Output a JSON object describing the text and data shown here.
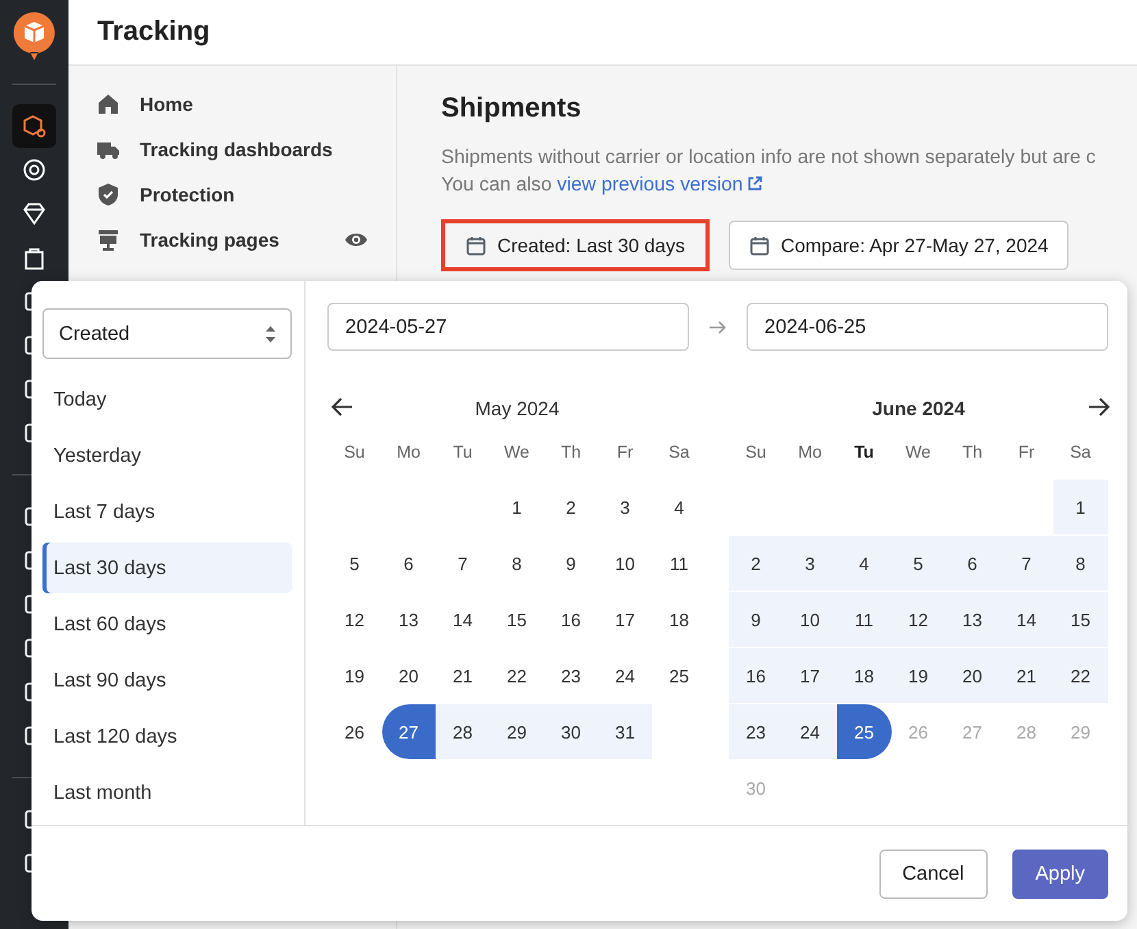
{
  "header": {
    "title": "Tracking"
  },
  "rail_items": [
    {
      "selected": true
    },
    {
      "selected": false
    },
    {
      "selected": false
    },
    {
      "selected": false
    }
  ],
  "sidebar": {
    "items": [
      {
        "label": "Home",
        "kind": "home",
        "preview": false
      },
      {
        "label": "Tracking dashboards",
        "kind": "truck",
        "preview": false
      },
      {
        "label": "Protection",
        "kind": "shield",
        "preview": false
      },
      {
        "label": "Tracking pages",
        "kind": "monitor",
        "preview": true
      }
    ]
  },
  "main": {
    "title": "Shipments",
    "description": "Shipments without carrier or location info are not shown separately but are c",
    "link_prefix": "You can also ",
    "link": "view previous version",
    "filters": [
      {
        "label": "Created: Last 30 days",
        "highlighted": true
      },
      {
        "label": "Compare: Apr 27-May 27, 2024",
        "highlighted": false
      }
    ]
  },
  "picker": {
    "field": {
      "value": "Created"
    },
    "presets": [
      {
        "label": "Today",
        "selected": false
      },
      {
        "label": "Yesterday",
        "selected": false
      },
      {
        "label": "Last 7 days",
        "selected": false
      },
      {
        "label": "Last 30 days",
        "selected": true
      },
      {
        "label": "Last 60 days",
        "selected": false
      },
      {
        "label": "Last 90 days",
        "selected": false
      },
      {
        "label": "Last 120 days",
        "selected": false
      },
      {
        "label": "Last month",
        "selected": false
      }
    ],
    "start_date": "2024-05-27",
    "end_date": "2024-06-25",
    "calendars": [
      {
        "title": "May 2024",
        "current": false,
        "prev_arrow": true,
        "next_arrow": false,
        "weekdays": [
          {
            "label": "Su",
            "today": false
          },
          {
            "label": "Mo",
            "today": false
          },
          {
            "label": "Tu",
            "today": false
          },
          {
            "label": "We",
            "today": false
          },
          {
            "label": "Th",
            "today": false
          },
          {
            "label": "Fr",
            "today": false
          },
          {
            "label": "Sa",
            "today": false
          }
        ],
        "weeks": [
          [
            {
              "kind": "blank"
            },
            {
              "kind": "blank"
            },
            {
              "kind": "blank"
            },
            {
              "label": "1",
              "kind": "day"
            },
            {
              "label": "2",
              "kind": "day"
            },
            {
              "label": "3",
              "kind": "day"
            },
            {
              "label": "4",
              "kind": "day"
            }
          ],
          [
            {
              "label": "5",
              "kind": "day"
            },
            {
              "label": "6",
              "kind": "day"
            },
            {
              "label": "7",
              "kind": "day"
            },
            {
              "label": "8",
              "kind": "day"
            },
            {
              "label": "9",
              "kind": "day"
            },
            {
              "label": "10",
              "kind": "day"
            },
            {
              "label": "11",
              "kind": "day"
            }
          ],
          [
            {
              "label": "12",
              "kind": "day"
            },
            {
              "label": "13",
              "kind": "day"
            },
            {
              "label": "14",
              "kind": "day"
            },
            {
              "label": "15",
              "kind": "day"
            },
            {
              "label": "16",
              "kind": "day"
            },
            {
              "label": "17",
              "kind": "day"
            },
            {
              "label": "18",
              "kind": "day"
            }
          ],
          [
            {
              "label": "19",
              "kind": "day"
            },
            {
              "label": "20",
              "kind": "day"
            },
            {
              "label": "21",
              "kind": "day"
            },
            {
              "label": "22",
              "kind": "day"
            },
            {
              "label": "23",
              "kind": "day"
            },
            {
              "label": "24",
              "kind": "day"
            },
            {
              "label": "25",
              "kind": "day"
            }
          ],
          [
            {
              "label": "26",
              "kind": "day"
            },
            {
              "label": "27",
              "kind": "start"
            },
            {
              "label": "28",
              "kind": "range"
            },
            {
              "label": "29",
              "kind": "range"
            },
            {
              "label": "30",
              "kind": "range"
            },
            {
              "label": "31",
              "kind": "range"
            },
            {
              "kind": "blank"
            }
          ]
        ]
      },
      {
        "title": "June 2024",
        "current": true,
        "prev_arrow": false,
        "next_arrow": true,
        "weekdays": [
          {
            "label": "Su",
            "today": false
          },
          {
            "label": "Mo",
            "today": false
          },
          {
            "label": "Tu",
            "today": true
          },
          {
            "label": "We",
            "today": false
          },
          {
            "label": "Th",
            "today": false
          },
          {
            "label": "Fr",
            "today": false
          },
          {
            "label": "Sa",
            "today": false
          }
        ],
        "weeks": [
          [
            {
              "kind": "blank"
            },
            {
              "kind": "blank"
            },
            {
              "kind": "blank"
            },
            {
              "kind": "blank"
            },
            {
              "kind": "blank"
            },
            {
              "kind": "blank"
            },
            {
              "label": "1",
              "kind": "range"
            }
          ],
          [
            {
              "label": "2",
              "kind": "range"
            },
            {
              "label": "3",
              "kind": "range"
            },
            {
              "label": "4",
              "kind": "range"
            },
            {
              "label": "5",
              "kind": "range"
            },
            {
              "label": "6",
              "kind": "range"
            },
            {
              "label": "7",
              "kind": "range"
            },
            {
              "label": "8",
              "kind": "range"
            }
          ],
          [
            {
              "label": "9",
              "kind": "range"
            },
            {
              "label": "10",
              "kind": "range"
            },
            {
              "label": "11",
              "kind": "range"
            },
            {
              "label": "12",
              "kind": "range"
            },
            {
              "label": "13",
              "kind": "range"
            },
            {
              "label": "14",
              "kind": "range"
            },
            {
              "label": "15",
              "kind": "range"
            }
          ],
          [
            {
              "label": "16",
              "kind": "range"
            },
            {
              "label": "17",
              "kind": "range"
            },
            {
              "label": "18",
              "kind": "range"
            },
            {
              "label": "19",
              "kind": "range"
            },
            {
              "label": "20",
              "kind": "range"
            },
            {
              "label": "21",
              "kind": "range"
            },
            {
              "label": "22",
              "kind": "range"
            }
          ],
          [
            {
              "label": "23",
              "kind": "range"
            },
            {
              "label": "24",
              "kind": "range"
            },
            {
              "label": "25",
              "kind": "end"
            },
            {
              "label": "26",
              "kind": "disabled"
            },
            {
              "label": "27",
              "kind": "disabled"
            },
            {
              "label": "28",
              "kind": "disabled"
            },
            {
              "label": "29",
              "kind": "disabled"
            }
          ],
          [
            {
              "label": "30",
              "kind": "disabled"
            },
            {
              "kind": "blank"
            },
            {
              "kind": "blank"
            },
            {
              "kind": "blank"
            },
            {
              "kind": "blank"
            },
            {
              "kind": "blank"
            },
            {
              "kind": "blank"
            }
          ]
        ]
      }
    ],
    "buttons": [
      {
        "label": "Cancel",
        "kind": "secondary"
      },
      {
        "label": "Apply",
        "kind": "primary"
      }
    ]
  }
}
